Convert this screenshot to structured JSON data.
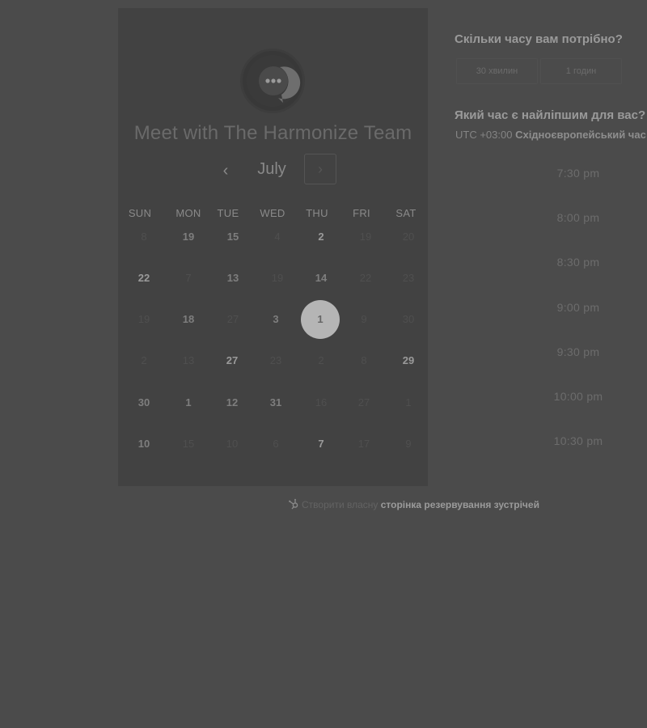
{
  "calendar": {
    "title": "Meet with The Harmonize Team",
    "avatar_icon": "chat-bubble-icon",
    "month": "July",
    "prev_symbol": "‹",
    "next_symbol": "›",
    "weekdays": [
      "SUN",
      "MON",
      "TUE",
      "WED",
      "THU",
      "FRI",
      "SAT"
    ],
    "rows": [
      [
        "8",
        "19",
        "15",
        "4",
        "2",
        "19",
        "20"
      ],
      [
        "22",
        "7",
        "13",
        "19",
        "14",
        "22",
        "23"
      ],
      [
        "19",
        "18",
        "27",
        "3",
        "1",
        "9",
        "30"
      ],
      [
        "2",
        "13",
        "27",
        "23",
        "2",
        "8",
        "29"
      ],
      [
        "30",
        "1",
        "12",
        "31",
        "16",
        "27",
        "1"
      ],
      [
        "10",
        "15",
        "10",
        "6",
        "7",
        "17",
        "9"
      ]
    ],
    "selected_day": "1"
  },
  "booking": {
    "duration_question": "Скільки часу вам потрібно?",
    "durations": [
      "30 хвилин",
      "1 годин"
    ],
    "time_question": "Який час є найліпшим для вас?",
    "timezone_offset": "UTC +03:00",
    "timezone_name": "Східноєвропейський час",
    "slots": [
      "7:30 pm",
      "8:00 pm",
      "8:30 pm",
      "9:00 pm",
      "9:30 pm",
      "10:00 pm",
      "10:30 pm"
    ]
  },
  "footer": {
    "icon": "hubspot-sprocket-icon",
    "prefix": "Створити власну",
    "link": "сторінка резервування зустрічей"
  },
  "colors": {
    "background": "#4b4b4b",
    "panel": "#424242",
    "selected_day": "#b5b5b5"
  }
}
